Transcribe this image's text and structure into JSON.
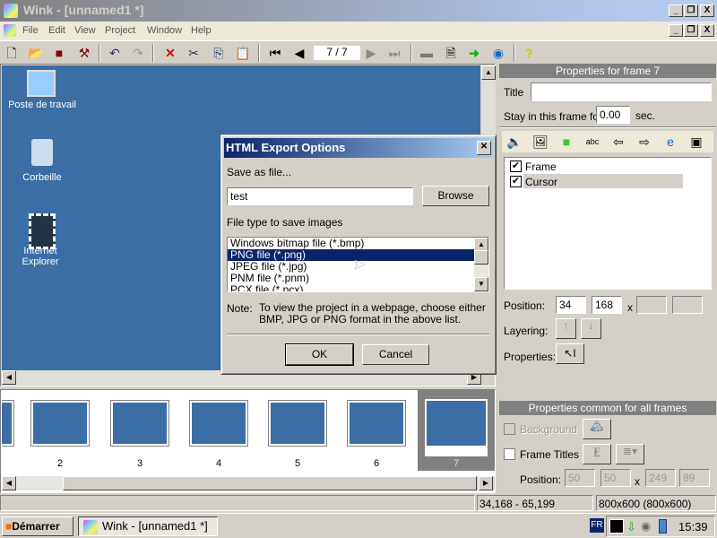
{
  "window": {
    "title": "Wink - [unnamed1 *]"
  },
  "menu": [
    "File",
    "Edit",
    "View",
    "Project",
    "Window",
    "Help"
  ],
  "toolbar": {
    "frame_counter": "7 / 7",
    "icons": [
      "new-icon",
      "open-icon",
      "save-icon",
      "render-icon",
      "undo-icon",
      "redo-icon",
      "delete-icon",
      "cut-icon",
      "copy-icon",
      "paste-icon",
      "first-frame-icon",
      "prev-frame-icon",
      "next-frame-icon",
      "last-frame-icon",
      "preview-icon",
      "properties-icon",
      "export-icon",
      "browser-icon",
      "help-icon"
    ]
  },
  "desktop": {
    "icons": [
      "Poste de travail",
      "Corbeille",
      "Internet Explorer"
    ]
  },
  "dialog": {
    "title": "HTML Export Options",
    "save_label": "Save as file...",
    "filename": "test",
    "browse": "Browse",
    "filetype_label": "File type to save images",
    "filetypes": [
      "Windows bitmap file (*.bmp)",
      "PNG file (*.png)",
      "JPEG file (*.jpg)",
      "PNM file (*.pnm)",
      "PCX file (*.pcx)"
    ],
    "selected": "PNG file (*.png)",
    "note_label": "Note:",
    "note": "To view the project in a webpage, choose either BMP, JPG or PNG format in the above list.",
    "ok": "OK",
    "cancel": "Cancel"
  },
  "frames": {
    "numbers": [
      "2",
      "3",
      "4",
      "5",
      "6",
      "7"
    ],
    "selected": "7"
  },
  "props": {
    "header": "Properties for frame 7",
    "title_label": "Title",
    "title_value": "",
    "stay_label": "Stay in this frame for",
    "stay_value": "0.00",
    "sec": "sec.",
    "items": [
      {
        "label": "Frame",
        "checked": true
      },
      {
        "label": "Cursor",
        "checked": true
      }
    ],
    "position_label": "Position:",
    "pos_x": "34",
    "pos_y": "168",
    "pos_w": "",
    "pos_h": "",
    "x": "x",
    "layering_label": "Layering:",
    "properties_label": "Properties:"
  },
  "common": {
    "header": "Properties common for all frames",
    "background": "Background",
    "frame_titles": "Frame Titles",
    "position_label": "Position:",
    "pos": [
      "50",
      "50",
      "249",
      "89"
    ],
    "x": "x"
  },
  "status": {
    "coords": "34,168 - 65,199",
    "size": "800x600 (800x600)"
  },
  "taskbar": {
    "start": "Démarrer",
    "task": "Wink - [unnamed1 *]",
    "lang": "FR",
    "clock": "15:39"
  }
}
